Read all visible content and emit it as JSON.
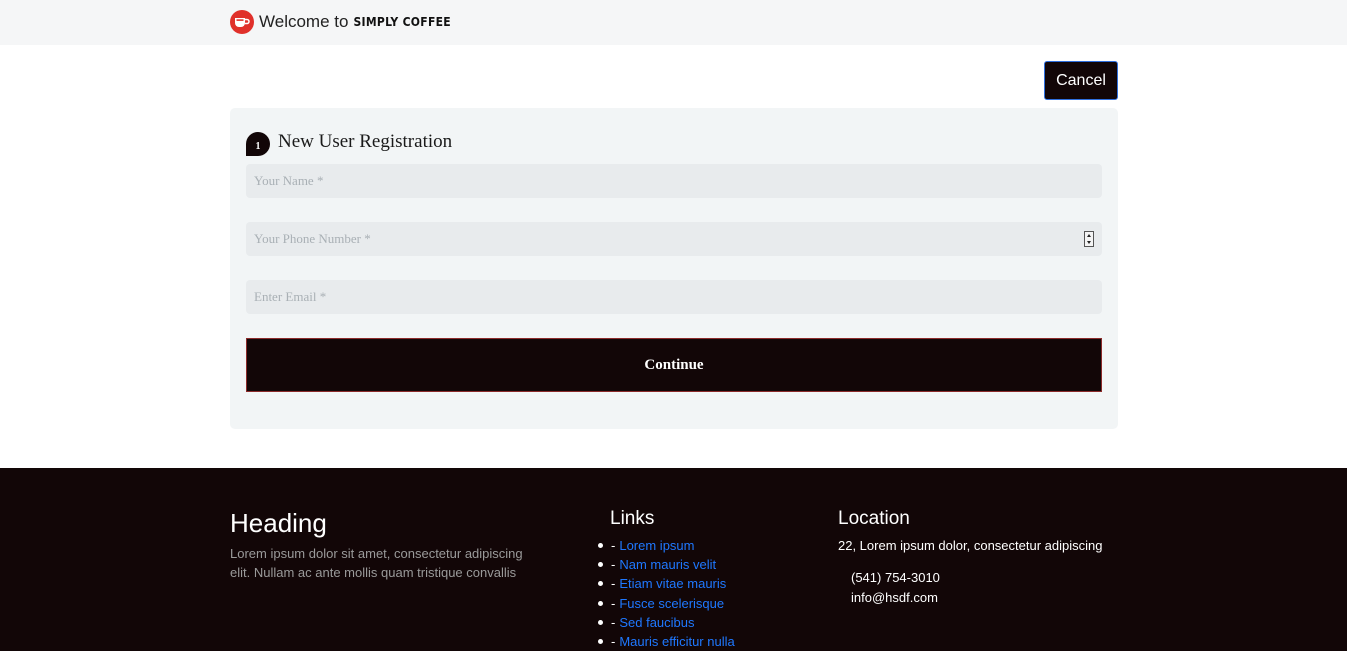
{
  "header": {
    "welcome_text": "Welcome to",
    "brand_name": "SIMPLY COFFEE",
    "logo_icon": "coffee-cup-icon",
    "logo_color": "#e0302a"
  },
  "actions": {
    "cancel_label": "Cancel"
  },
  "registration": {
    "step_number": "1",
    "title": "New User Registration",
    "name_placeholder": "Your Name *",
    "phone_placeholder": "Your Phone Number *",
    "email_placeholder": "Enter Email *",
    "continue_label": "Continue"
  },
  "footer": {
    "heading": "Heading",
    "description": "Lorem ipsum dolor sit amet, consectetur adipiscing elit. Nullam ac ante mollis quam tristique convallis",
    "links_title": "Links",
    "links": [
      "Lorem ipsum",
      "Nam mauris velit",
      "Etiam vitae mauris",
      "Fusce scelerisque",
      "Sed faucibus",
      "Mauris efficitur nulla"
    ],
    "location_title": "Location",
    "address": "22, Lorem ipsum dolor, consectetur adipiscing",
    "phone": "(541) 754-3010",
    "email": "info@hsdf.com"
  },
  "colors": {
    "dark": "#120607",
    "link": "#1f78ff",
    "card_bg": "#f2f5f6"
  }
}
